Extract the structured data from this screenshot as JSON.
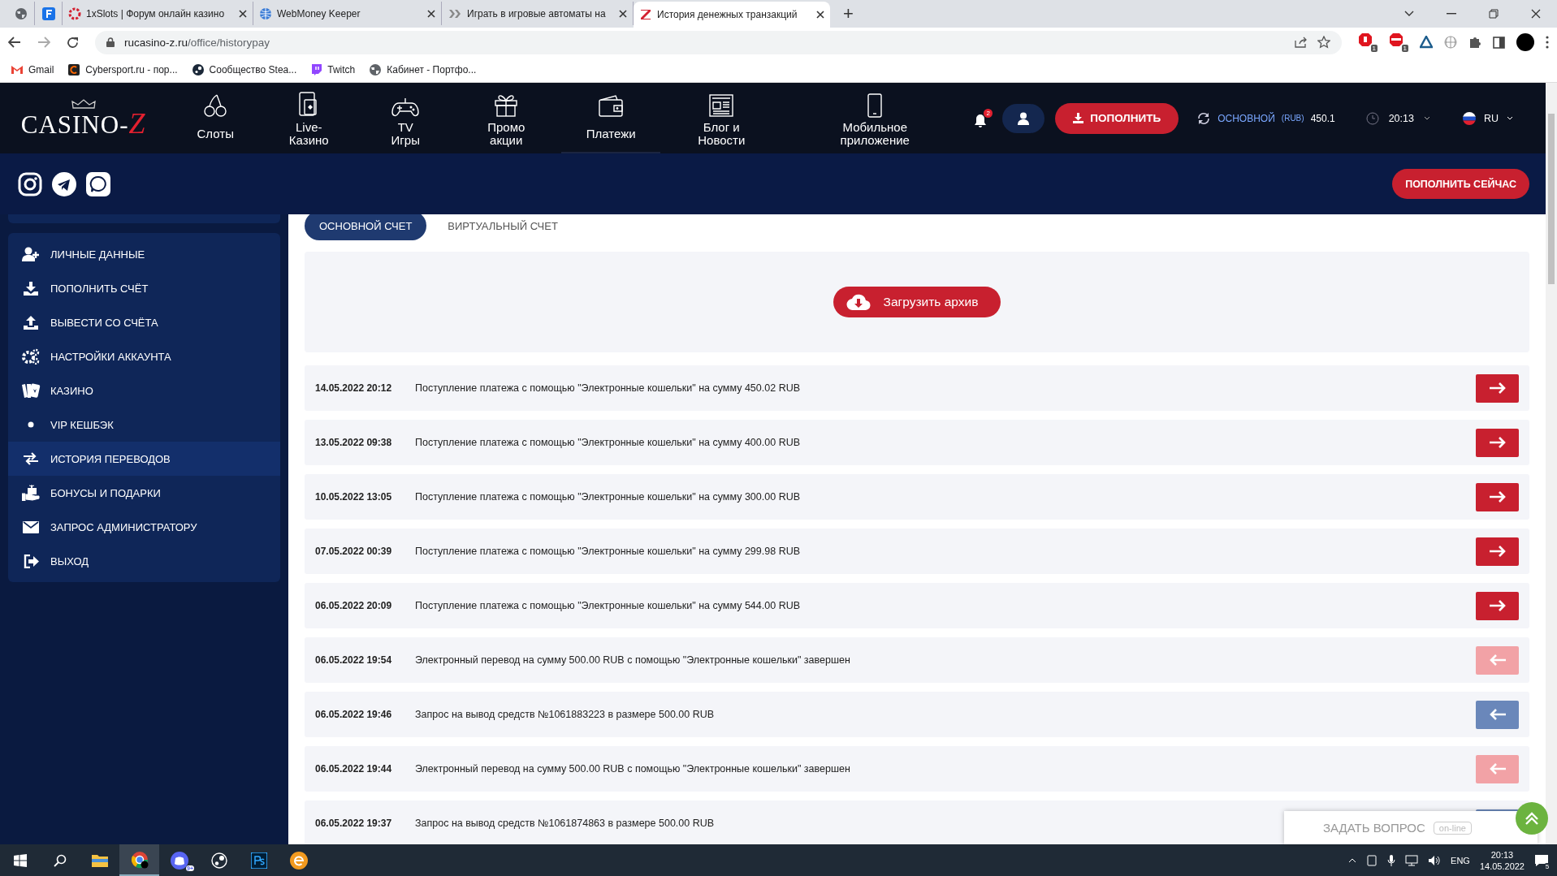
{
  "browser": {
    "tabs": [
      {
        "selected": false
      },
      {
        "selected": false
      },
      {
        "title": "1xSlots | Форум онлайн казино",
        "selected": false
      },
      {
        "title": "WebMoney Keeper",
        "selected": false
      },
      {
        "title": "Играть в игровые автоматы на",
        "selected": false
      },
      {
        "title": "История денежных транзакций",
        "selected": true
      }
    ],
    "new_tab_button": "+",
    "address": {
      "host": "rucasino-z.ru",
      "path": "/office/historypay"
    },
    "extension_badges": [
      "1",
      "1"
    ],
    "bookmarks": [
      "Gmail",
      "Cybersport.ru - пор...",
      "Сообщество Stea...",
      "Twitch",
      "Кабинет - Портфо..."
    ]
  },
  "header": {
    "logo": {
      "text": "CASINO-",
      "accent": "Z"
    },
    "nav": [
      {
        "lines": [
          "Слоты"
        ],
        "selected": false
      },
      {
        "lines": [
          "Live-",
          "Казино"
        ],
        "selected": false
      },
      {
        "lines": [
          "TV",
          "Игры"
        ],
        "selected": false
      },
      {
        "lines": [
          "Промо",
          "акции"
        ],
        "selected": false
      },
      {
        "lines": [
          "Платежи"
        ],
        "selected": true
      },
      {
        "lines": [
          "Блог и",
          "Новости"
        ],
        "selected": false
      },
      {
        "lines": [
          "Мобильное",
          "приложение"
        ],
        "selected": false
      }
    ],
    "notification_count": "2",
    "deposit_button": "ПОПОЛНИТЬ",
    "balance": {
      "label": "ОСНОВНОЙ",
      "currency": "(RUB)",
      "amount": "450.1"
    },
    "time": "20:13",
    "language": "RU",
    "deposit_now_button": "ПОПОЛНИТЬ СЕЙЧАС"
  },
  "sidebar": {
    "items": [
      {
        "label": "ЛИЧНЫЕ ДАННЫЕ",
        "selected": false
      },
      {
        "label": "ПОПОЛНИТЬ СЧЁТ",
        "selected": false
      },
      {
        "label": "ВЫВЕСТИ СО СЧЁТА",
        "selected": false
      },
      {
        "label": "НАСТРОЙКИ АККАУНТА",
        "selected": false
      },
      {
        "label": "КАЗИНО",
        "selected": false
      },
      {
        "label": "VIP КЕШБЭК",
        "selected": false
      },
      {
        "label": "ИСТОРИЯ ПЕРЕВОДОВ",
        "selected": true
      },
      {
        "label": "БОНУСЫ И ПОДАРКИ",
        "selected": false
      },
      {
        "label": "ЗАПРОС АДМИНИСТРАТОРУ",
        "selected": false
      },
      {
        "label": "ВЫХОД",
        "selected": false
      }
    ]
  },
  "account_tabs": [
    {
      "label": "ОСНОВНОЙ СЧЕТ",
      "selected": true
    },
    {
      "label": "ВИРТУАЛЬНЫЙ СЧЕТ",
      "selected": false
    }
  ],
  "archive_button": "Загрузить архив",
  "transactions": [
    {
      "date": "14.05.2022 20:12",
      "text": "Поступление платежа с помощью \"Электронные кошельки\" на сумму 450.02 RUB",
      "kind": "deposit"
    },
    {
      "date": "13.05.2022 09:38",
      "text": "Поступление платежа с помощью \"Электронные кошельки\" на сумму 400.00 RUB",
      "kind": "deposit"
    },
    {
      "date": "10.05.2022 13:05",
      "text": "Поступление платежа с помощью \"Электронные кошельки\" на сумму 300.00 RUB",
      "kind": "deposit"
    },
    {
      "date": "07.05.2022 00:39",
      "text": "Поступление платежа с помощью \"Электронные кошельки\" на сумму 299.98 RUB",
      "kind": "deposit"
    },
    {
      "date": "06.05.2022 20:09",
      "text": "Поступление платежа с помощью \"Электронные кошельки\" на сумму 544.00 RUB",
      "kind": "deposit"
    },
    {
      "date": "06.05.2022 19:54",
      "text": "Электронный перевод на сумму 500.00 RUB с помощью \"Электронные кошельки\" завершен",
      "kind": "transfer"
    },
    {
      "date": "06.05.2022 19:46",
      "text": "Запрос на вывод средств №1061883223 в размере 500.00 RUB",
      "kind": "withdrawal"
    },
    {
      "date": "06.05.2022 19:44",
      "text": "Электронный перевод на сумму 500.00 RUB с помощью \"Электронные кошельки\" завершен",
      "kind": "transfer"
    },
    {
      "date": "06.05.2022 19:37",
      "text": "Запрос на вывод средств №1061874863 в размере 500.00 RUB",
      "kind": "withdrawal"
    }
  ],
  "chat_widget": {
    "label": "ЗАДАТЬ ВОПРОС",
    "status": "on-line"
  },
  "taskbar": {
    "discord_badge": "9+",
    "language": "ENG",
    "time": "20:13",
    "date": "14.05.2022",
    "notification_count": "5"
  }
}
